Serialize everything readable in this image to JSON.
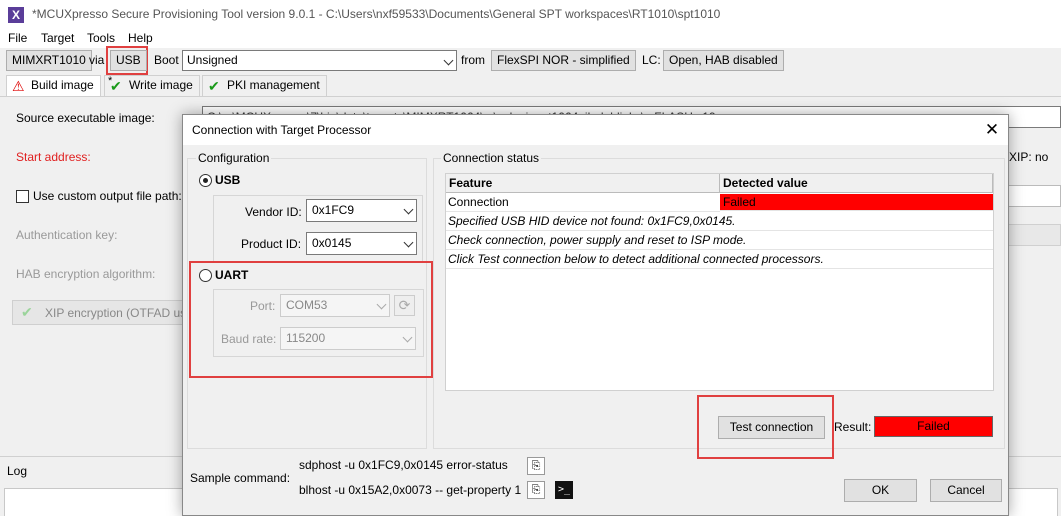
{
  "window": {
    "title": "*MCUXpresso Secure Provisioning Tool version 9.0.1 - C:\\Users\\nxf59533\\Documents\\General SPT workspaces\\RT1010\\spt1010",
    "app_icon": "X"
  },
  "menu": [
    "File",
    "Target",
    "Tools",
    "Help"
  ],
  "toolbar": {
    "processor": "MIMXRT1010",
    "via_label": "via",
    "interface": "USB",
    "boot_label": "Boot",
    "boot_value": "Unsigned",
    "from_label": "from",
    "boot_device": "FlexSPI NOR - simplified",
    "lc_label": "LC:",
    "lifecycle": "Open, HAB disabled"
  },
  "tabs": [
    {
      "label": "Build image",
      "icon": "warning-icon",
      "marker": "*"
    },
    {
      "label": "Write image",
      "icon": "check-icon"
    },
    {
      "label": "PKI management",
      "icon": "check-icon"
    }
  ],
  "build": {
    "source_label": "Source executable image:",
    "source_value": "C:\\...\\MCUXpresso\\7\\bin\\data\\targets\\MIMXRT1064\\...\\evkmimxrt1064_iled_blinky\\...FLASH.s19",
    "start_label": "Start address:",
    "xip_label": "XIP: no",
    "custom_output_label": "Use custom output file path:",
    "auth_key_label": "Authentication key:",
    "hab_enc_label": "HAB encryption algorithm:",
    "xip_enc_label": "XIP encryption (OTFAD us"
  },
  "log": {
    "label": "Log"
  },
  "dialog": {
    "title": "Connection with Target Processor",
    "close": "✕",
    "configuration": {
      "title": "Configuration",
      "usb_label": "USB",
      "vendor_label": "Vendor ID:",
      "vendor_value": "0x1FC9",
      "product_label": "Product ID:",
      "product_value": "0x0145",
      "uart_label": "UART",
      "port_label": "Port:",
      "port_value": "COM53",
      "baud_label": "Baud rate:",
      "baud_value": "115200"
    },
    "status": {
      "title": "Connection status",
      "headers": [
        "Feature",
        "Detected value"
      ],
      "row_feature": "Connection",
      "row_value": "Failed",
      "messages": [
        "Specified USB HID device not found: 0x1FC9,0x0145.",
        "Check connection, power supply and reset to ISP mode.",
        "Click Test connection below to detect additional connected processors."
      ]
    },
    "test_button": "Test connection",
    "result_label": "Result:",
    "result_value": "Failed",
    "sample_label": "Sample command:",
    "sample_cmd1": "sdphost -u 0x1FC9,0x0145 error-status",
    "sample_cmd2": "blhost -u 0x15A2,0x0073 -- get-property 1",
    "ok": "OK",
    "cancel": "Cancel"
  },
  "colors": {
    "failed": "#ff0000",
    "highlight": "#e04040",
    "check": "#1a9a1a"
  }
}
